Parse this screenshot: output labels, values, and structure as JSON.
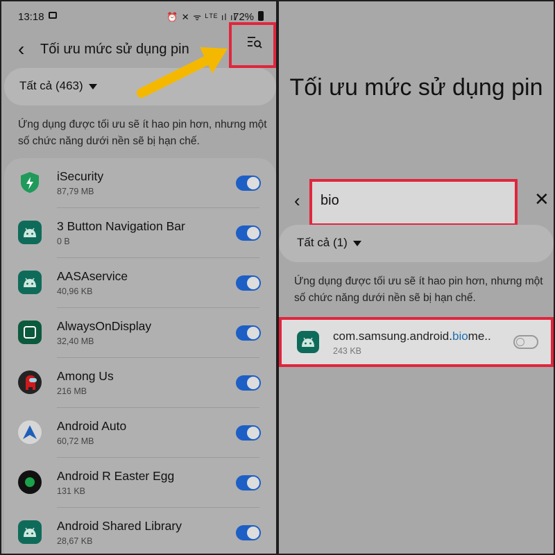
{
  "status_bar": {
    "time": "13:18",
    "icons": "⏰ ✕ ᯤ ᴸᵀᴱ ıl ıl",
    "battery": "72%"
  },
  "left": {
    "title": "Tối ưu mức sử dụng pin",
    "filter_label": "Tất cả (463)",
    "description": "Ứng dụng được tối ưu sẽ ít hao pin hơn, nhưng một số chức năng dưới nền sẽ bị hạn chế.",
    "apps": [
      {
        "name": "iSecurity",
        "size": "87,79 MB",
        "icon": "shield-icon",
        "enabled": true
      },
      {
        "name": "3 Button Navigation Bar",
        "size": "0 B",
        "icon": "android-icon",
        "enabled": true
      },
      {
        "name": "AASAservice",
        "size": "40,96 KB",
        "icon": "android-icon",
        "enabled": true
      },
      {
        "name": "AlwaysOnDisplay",
        "size": "32,40 MB",
        "icon": "clock-icon",
        "enabled": true
      },
      {
        "name": "Among Us",
        "size": "216 MB",
        "icon": "among-us-icon",
        "enabled": true
      },
      {
        "name": "Android Auto",
        "size": "60,72 MB",
        "icon": "android-auto-icon",
        "enabled": true
      },
      {
        "name": "Android R Easter Egg",
        "size": "131 KB",
        "icon": "easter-egg-icon",
        "enabled": true
      },
      {
        "name": "Android Shared Library",
        "size": "28,67 KB",
        "icon": "android-icon",
        "enabled": true
      }
    ]
  },
  "right": {
    "title": "Tối ưu mức sử dụng pin",
    "search_value": "bio",
    "filter_label": "Tất cả (1)",
    "description": "Ứng dụng được tối ưu sẽ ít hao pin hơn, nhưng một số chức năng dưới nền sẽ bị hạn chế.",
    "result": {
      "name_prefix": "com.samsung.android.",
      "name_highlight": "bio",
      "name_suffix": "me..",
      "size": "243 KB",
      "enabled": false
    }
  },
  "colors": {
    "highlight_border": "#e0263d",
    "arrow": "#f5b800",
    "toggle_on": "#1d5fc4",
    "search_highlight": "#1d6fb0"
  }
}
